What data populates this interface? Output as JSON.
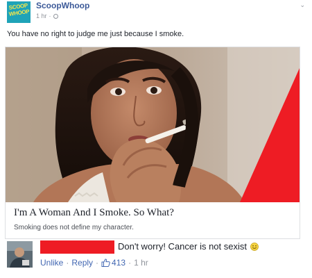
{
  "post": {
    "page_name": "ScoopWhoop",
    "time": "1 hr",
    "text": "You have no right to judge me just because I smoke.",
    "logo_text": "SCOOP WHOOP"
  },
  "link_card": {
    "title": "I'm A Woman And I Smoke. So What?",
    "description": "Smoking does not define my character."
  },
  "comment": {
    "text": "Don't worry! Cancer is not sexist",
    "unlike_label": "Unlike",
    "reply_label": "Reply",
    "like_count": "413",
    "time": "1 hr",
    "redaction_color": "#ee1c24"
  },
  "icons": {
    "globe": "globe-icon",
    "chevron": "chevron-down-icon",
    "thumb": "thumbs-up-icon",
    "smiley": "smiley-icon"
  },
  "colors": {
    "link_blue": "#4267b2",
    "name_blue": "#3b5998",
    "meta_gray": "#90949c",
    "logo_bg": "#1fa3b8",
    "logo_fg": "#f7e64a",
    "red_accent": "#ee1c24"
  }
}
